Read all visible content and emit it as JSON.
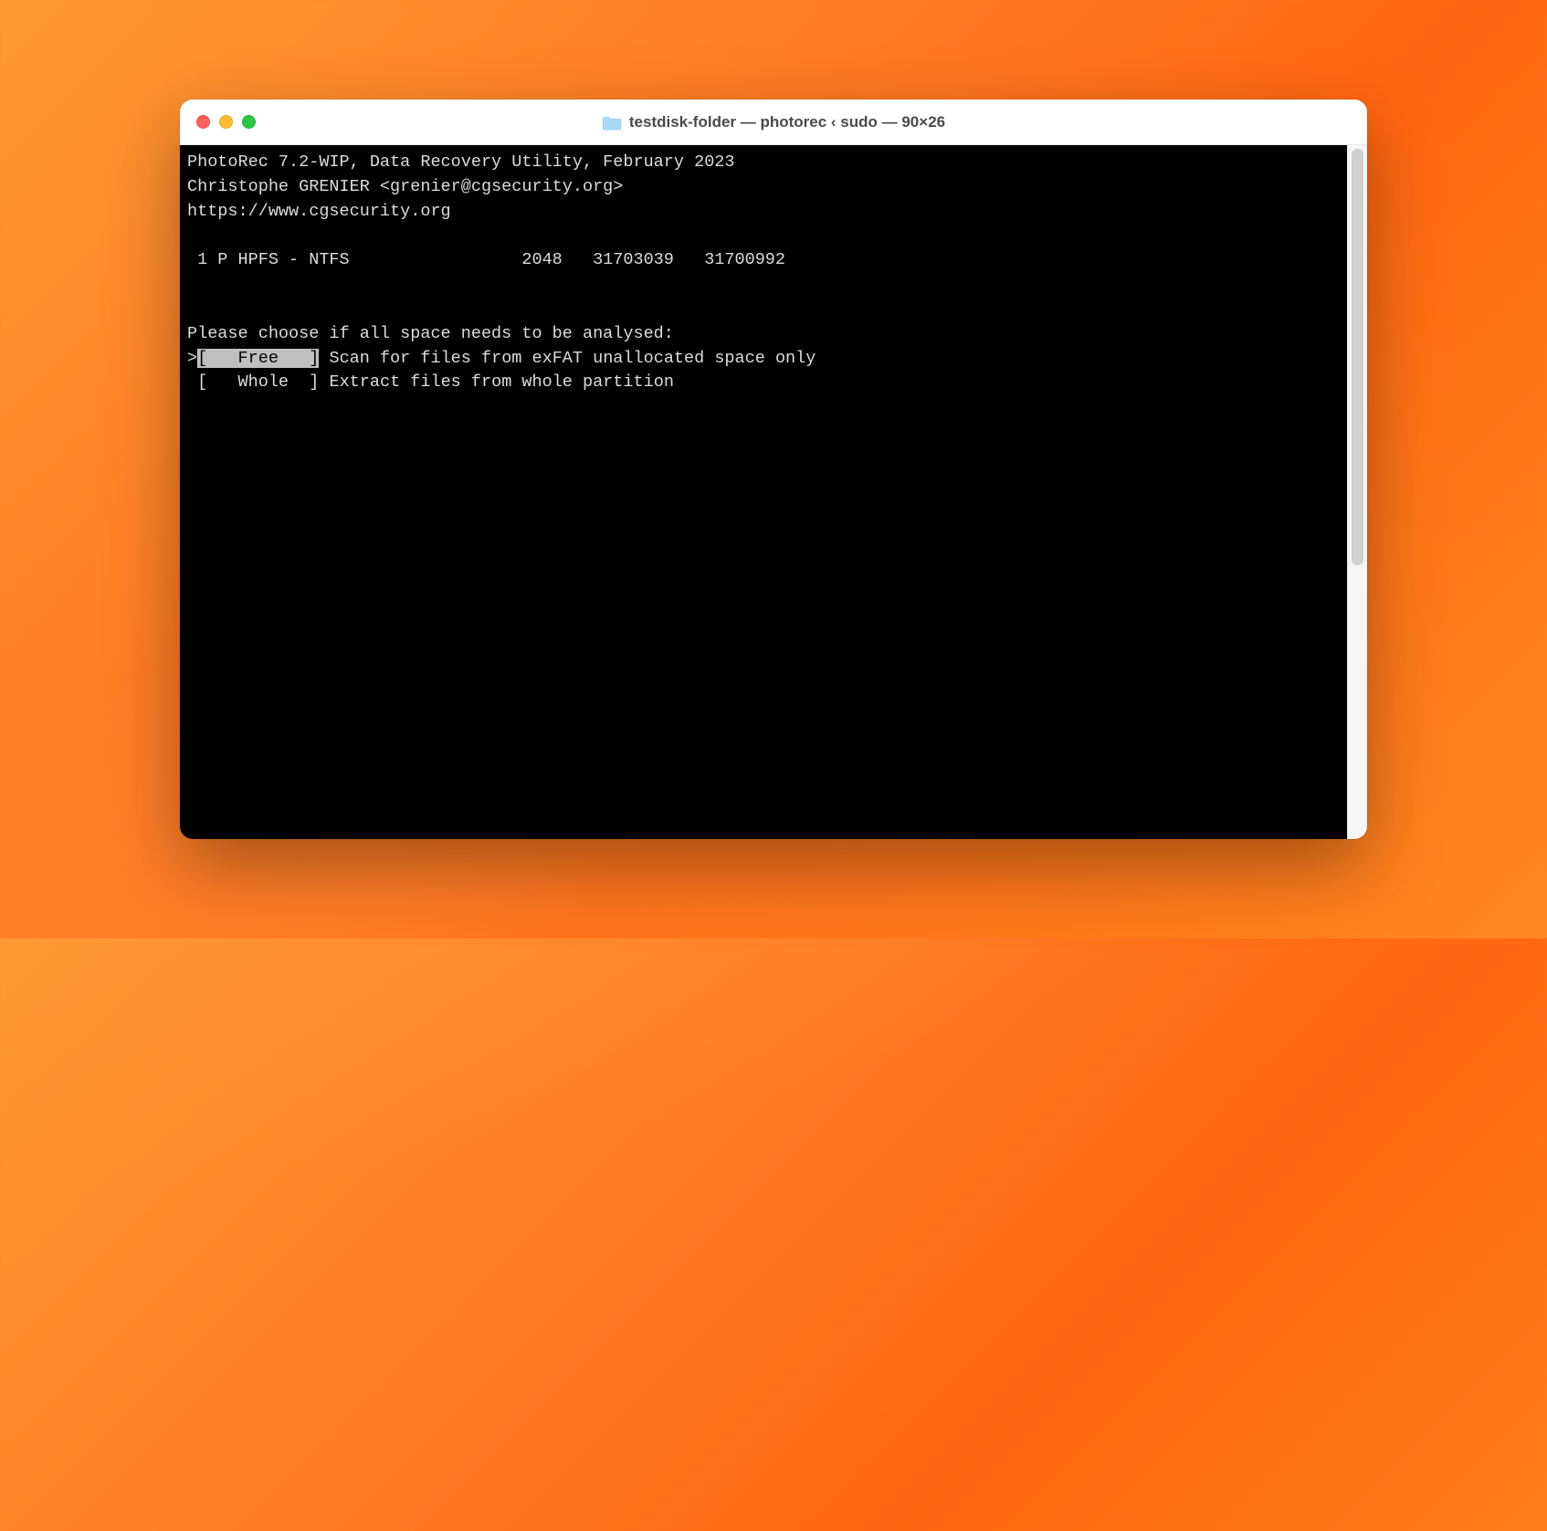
{
  "window": {
    "title": "testdisk-folder — photorec ‹ sudo — 90×26"
  },
  "terminal": {
    "header": {
      "line1": "PhotoRec 7.2-WIP, Data Recovery Utility, February 2023",
      "line2": "Christophe GRENIER <grenier@cgsecurity.org>",
      "line3": "https://www.cgsecurity.org"
    },
    "partition_line": " 1 P HPFS - NTFS                 2048   31703039   31700992",
    "prompt": "Please choose if all space needs to be analysed:",
    "options": [
      {
        "prefix": ">",
        "bracket_open": "[",
        "label": "   Free   ",
        "bracket_close": "]",
        "desc": " Scan for files from exFAT unallocated space only",
        "selected": true
      },
      {
        "prefix": " ",
        "bracket_open": "[",
        "label": "   Whole  ",
        "bracket_close": "]",
        "desc": " Extract files from whole partition",
        "selected": false
      }
    ]
  }
}
